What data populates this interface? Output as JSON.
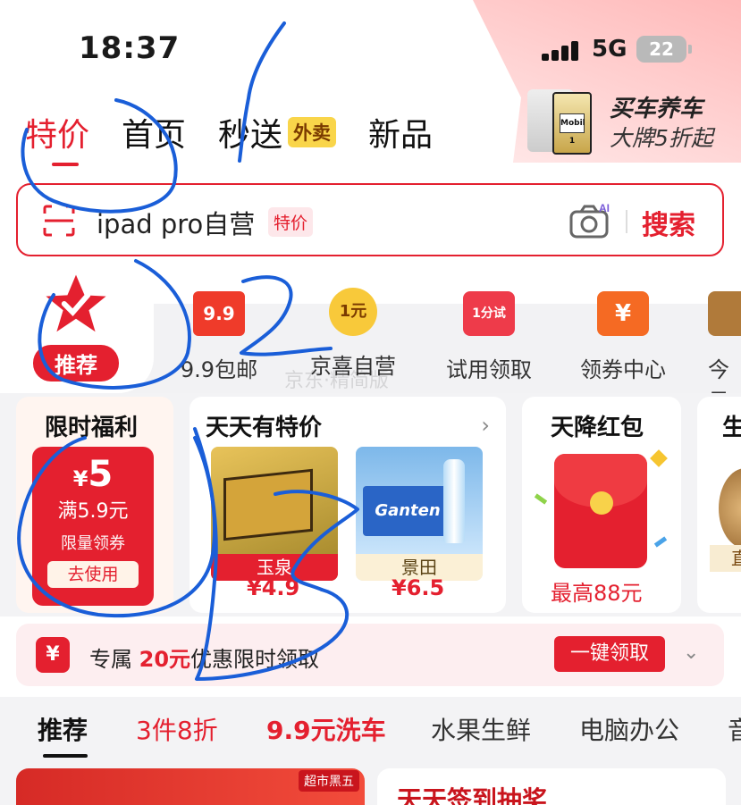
{
  "status_bar": {
    "time": "18:37",
    "network": "5G",
    "battery": "22"
  },
  "promo_banner": {
    "title": "买车养车",
    "subtitle": "大牌5折起",
    "can_label": "Mobil 1"
  },
  "top_tabs": [
    {
      "label": "特价",
      "active": true
    },
    {
      "label": "首页",
      "active": false
    },
    {
      "label": "秒送",
      "badge": "外卖",
      "active": false
    },
    {
      "label": "新品",
      "active": false
    }
  ],
  "search": {
    "query": "ipad pro自营",
    "tag": "特价",
    "button": "搜索",
    "camera_badge": "AI"
  },
  "categories": [
    {
      "label": "推荐",
      "icon": "star-check-icon",
      "active": true
    },
    {
      "label": "9.9包邮",
      "icon": "price-9-9-icon",
      "icon_text": "9.9"
    },
    {
      "label": "京喜自营",
      "icon": "one-yuan-icon",
      "icon_text": "1元"
    },
    {
      "label": "试用领取",
      "icon": "trial-bag-icon",
      "icon_text": "1分试"
    },
    {
      "label": "领券中心",
      "icon": "coupon-center-icon",
      "icon_text": "¥"
    },
    {
      "label": "今日",
      "icon": "today-icon"
    }
  ],
  "panels": {
    "welfare": {
      "title": "限时福利",
      "currency": "¥",
      "amount": "5",
      "condition": "满5.9元",
      "limit": "限量领券",
      "button": "去使用"
    },
    "daily_deals": {
      "title": "天天有特价",
      "products": [
        {
          "label": "玉泉",
          "price": "¥4.9"
        },
        {
          "label": "景田",
          "price": "¥6.5"
        }
      ]
    },
    "red_packet": {
      "title": "天降红包",
      "text": "最高88元"
    },
    "partial": {
      "title": "生",
      "label": "直"
    }
  },
  "notice": {
    "icon": "¥",
    "prefix": "专属",
    "highlight": "20元",
    "suffix": "优惠限时领取",
    "button": "一键领取"
  },
  "feed_tabs": [
    {
      "label": "推荐",
      "active": true,
      "color": "#111111"
    },
    {
      "label": "3件8折",
      "color": "#e4202f"
    },
    {
      "label": "9.9元洗车",
      "color": "#e4202f"
    },
    {
      "label": "水果生鲜",
      "color": "#333333"
    },
    {
      "label": "电脑办公",
      "color": "#333333"
    },
    {
      "label": "音",
      "color": "#333333"
    }
  ],
  "feed_cards": {
    "card1_badge": "超市黑五",
    "card2_title": "天天签到抽奖"
  },
  "watermark": "京东·精简版",
  "colors": {
    "accent": "#e4202f",
    "scribble": "#1a5ed8"
  }
}
